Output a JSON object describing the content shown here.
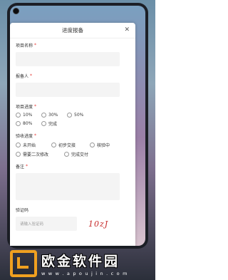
{
  "dialog": {
    "title": "进度报备",
    "close_icon": "close-icon"
  },
  "form": {
    "project_name": {
      "label": "项目名称",
      "required_mark": "*"
    },
    "reporter": {
      "label": "报备人",
      "required_mark": "*"
    },
    "progress": {
      "label": "项目进度",
      "required_mark": "*",
      "options": [
        "10%",
        "30%",
        "50%",
        "80%",
        "完成"
      ]
    },
    "acceptance": {
      "label": "验收进度",
      "required_mark": "*",
      "options": [
        "未开始",
        "初步交接",
        "核验中",
        "需要二次修改",
        "完成交付"
      ]
    },
    "remarks": {
      "label": "备注",
      "required_mark": "*"
    },
    "captcha": {
      "label": "验证码",
      "placeholder": "请输入验证码",
      "image_text": "10zJ"
    }
  },
  "watermark": {
    "brand": "欧金软件园",
    "url": "w w w . a p o u j i n . c o m"
  },
  "colors": {
    "accent_required": "#e53935",
    "watermark_orange": "#f0a020",
    "captcha_red": "#c62828"
  }
}
